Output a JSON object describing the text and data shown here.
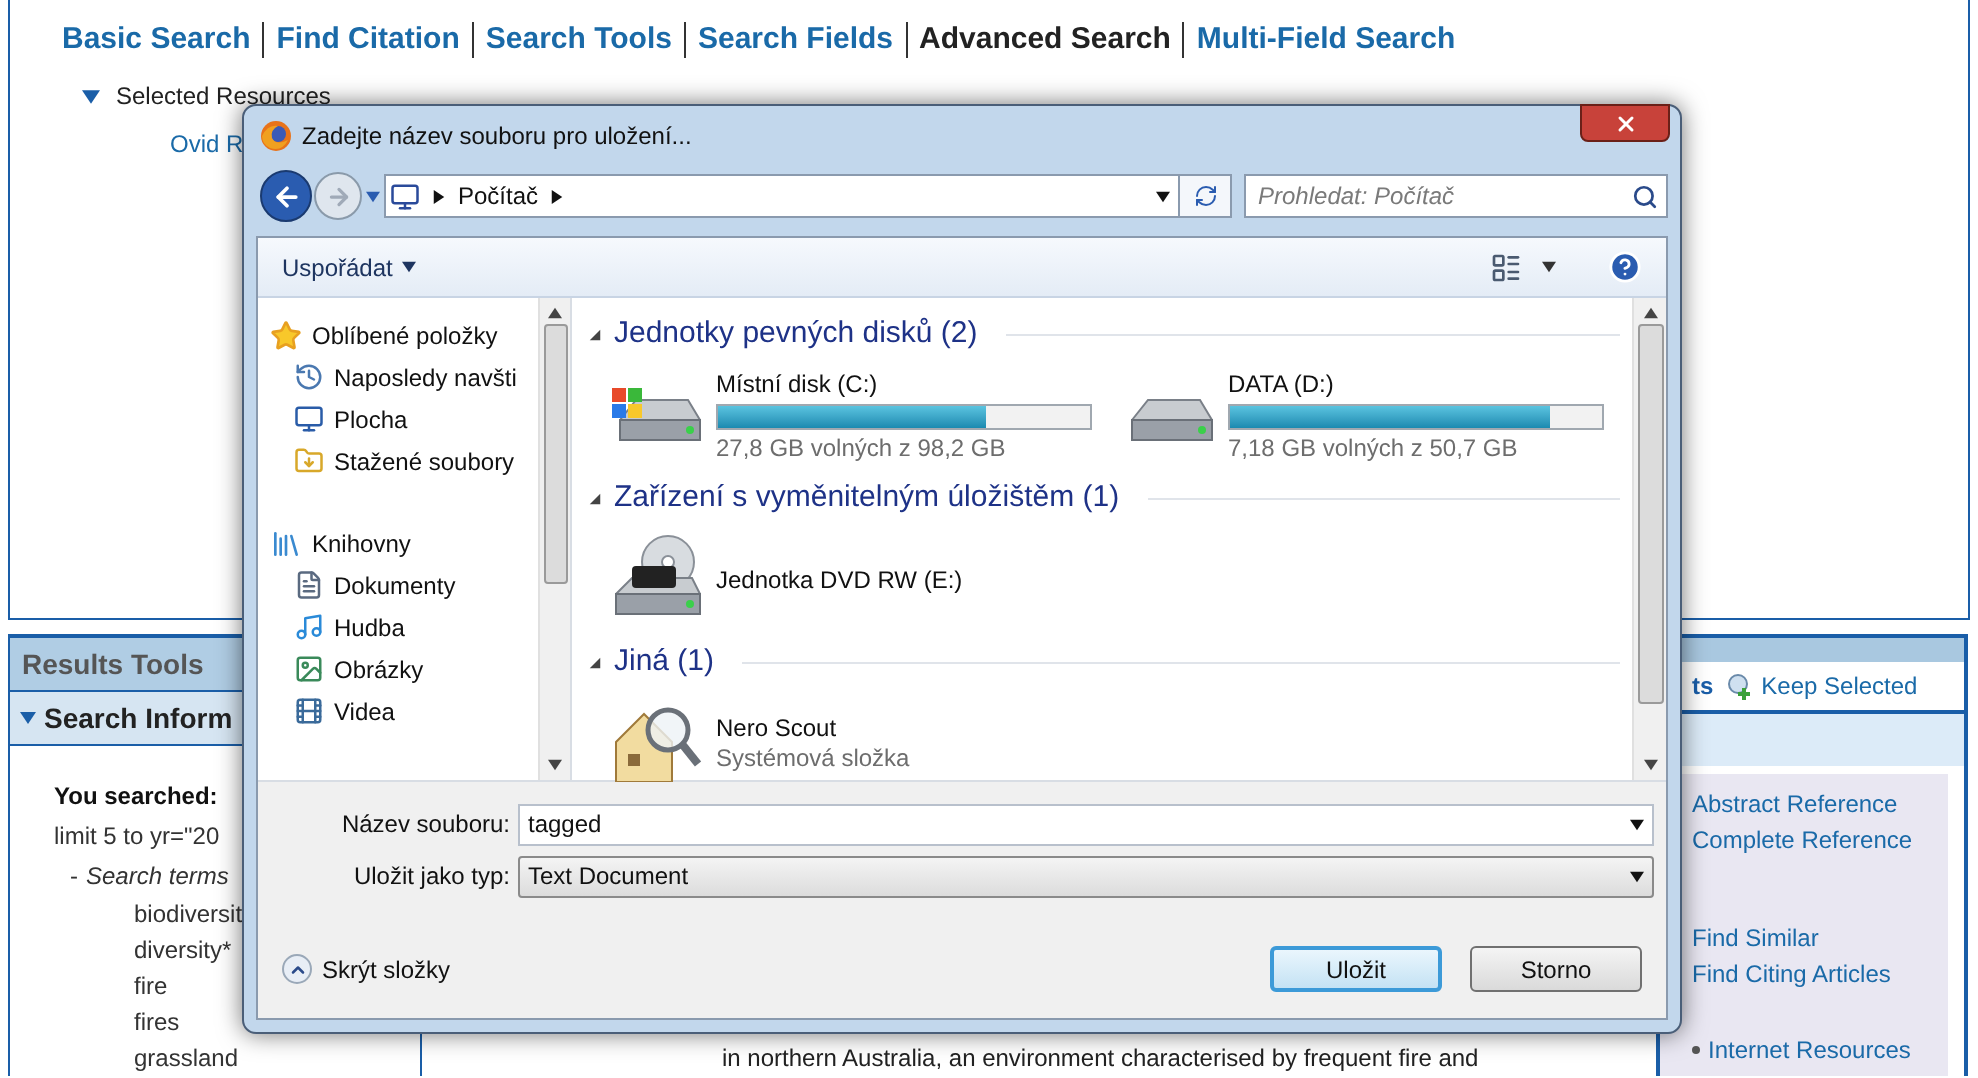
{
  "nav_tabs": [
    {
      "label": "Basic Search",
      "selected": false
    },
    {
      "label": "Find Citation",
      "selected": false
    },
    {
      "label": "Search Tools",
      "selected": false
    },
    {
      "label": "Search Fields",
      "selected": false
    },
    {
      "label": "Advanced Search",
      "selected": true
    },
    {
      "label": "Multi-Field Search",
      "selected": false
    }
  ],
  "resources": {
    "label": "Selected Resources",
    "expanded": true,
    "items": [
      "Ovid R"
    ]
  },
  "results_tools": {
    "title": "Results Tools",
    "section": "Search Inform",
    "section_expanded": true,
    "searched_label": "You searched:",
    "query": "limit 5 to yr=\"20",
    "dash": "-",
    "terms_label": "Search terms",
    "terms": [
      "biodiversit",
      "diversity*",
      "fire",
      "fires",
      "grassland"
    ]
  },
  "right_panel": {
    "tab_text": "ts",
    "keep_selected": "Keep Selected",
    "links": [
      "Abstract Reference",
      "Complete Reference",
      "Find Similar",
      "Find Citing Articles"
    ],
    "resources_link": "Internet Resources"
  },
  "abstract_line": "in northern Australia, an environment characterised by frequent fire and",
  "dialog": {
    "title": "Zadejte název souboru pro uložení...",
    "address": [
      "Počítač"
    ],
    "search_placeholder": "Prohledat: Počítač",
    "organize": "Uspořádat",
    "nav": [
      {
        "label": "Oblíbené položky",
        "children": [
          "Naposledy navšti",
          "Plocha",
          "Stažené soubory"
        ]
      },
      {
        "label": "Knihovny",
        "children": [
          "Dokumenty",
          "Hudba",
          "Obrázky",
          "Videa"
        ]
      }
    ],
    "groups": [
      {
        "title": "Jednotky pevných disků (2)",
        "expanded": true,
        "items": [
          {
            "kind": "drive",
            "name": "Místní disk (C:)",
            "system": true,
            "level": 0.72,
            "detail": "27,8 GB volných z 98,2 GB"
          },
          {
            "kind": "drive",
            "name": "DATA (D:)",
            "system": false,
            "level": 0.86,
            "detail": "7,18 GB volných z 50,7 GB"
          }
        ]
      },
      {
        "title": "Zařízení s vyměnitelným úložištěm (1)",
        "expanded": true,
        "items": [
          {
            "kind": "dvd",
            "name": "Jednotka DVD RW (E:)"
          }
        ]
      },
      {
        "title": "Jiná (1)",
        "expanded": true,
        "items": [
          {
            "kind": "folder",
            "name": "Nero Scout",
            "detail": "Systémová složka"
          }
        ]
      }
    ],
    "filename_label": "Název souboru:",
    "filename": "tagged",
    "type_label": "Uložit jako typ:",
    "type": "Text Document",
    "hide_folders": "Skrýt složky",
    "buttons": [
      {
        "label": "Uložit",
        "default": true
      },
      {
        "label": "Storno",
        "default": false
      }
    ]
  }
}
